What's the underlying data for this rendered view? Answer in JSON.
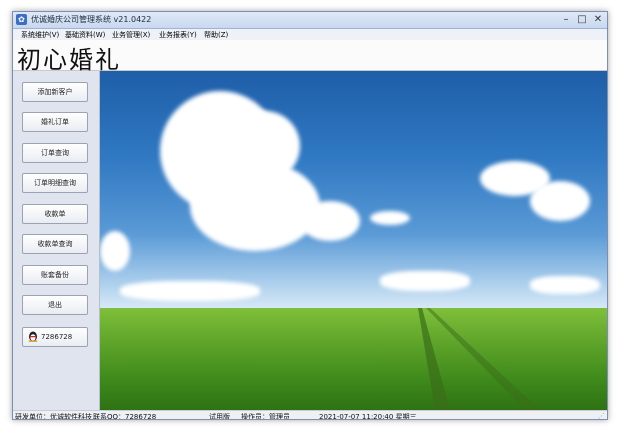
{
  "window": {
    "title": "优诚婚庆公司管理系统  v21.0422"
  },
  "menubar": {
    "items": [
      "系统维护(V)",
      "基础资料(W)",
      "业务管理(X)",
      "业务报表(Y)",
      "帮助(Z)"
    ]
  },
  "header": {
    "app_title": "初心婚礼"
  },
  "sidebar": {
    "buttons": [
      "添加新客户",
      "婚礼订单",
      "订单查询",
      "订单明细查询",
      "收款单",
      "收款单查询",
      "账套备份",
      "退出"
    ],
    "qq_label": "7286728"
  },
  "status": {
    "developer": "研发单位：优诚软件科技",
    "contact": "联系QQ：7286728",
    "edition": "试用版",
    "operator": "操作员：管理员",
    "datetime": "2021-07-07 11:20:40 星期三"
  },
  "colors": {
    "sky_top": "#1f5ea8",
    "grass": "#5ea42a"
  }
}
